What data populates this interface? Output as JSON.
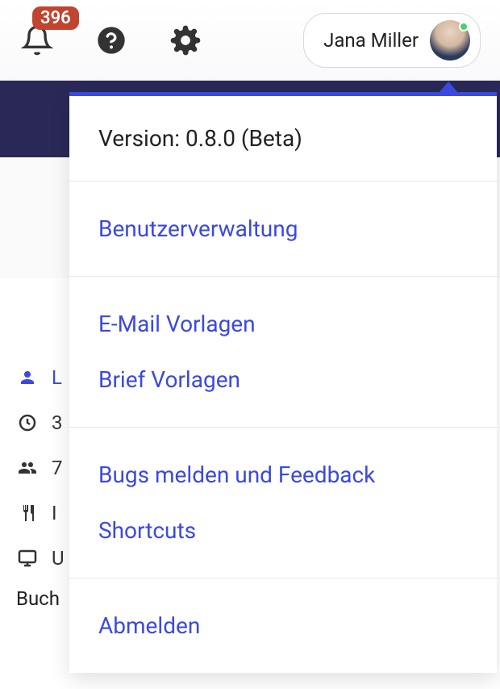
{
  "topbar": {
    "notification_count": "396",
    "user_name": "Jana Miller"
  },
  "dropdown": {
    "version": "Version: 0.8.0 (Beta)",
    "user_mgmt": "Benutzerverwaltung",
    "email_templates": "E-Mail Vorlagen",
    "letter_templates": "Brief Vorlagen",
    "bugs_feedback": "Bugs melden und Feedback",
    "shortcuts": "Shortcuts",
    "logout": "Abmelden"
  },
  "sidebar": {
    "items": [
      {
        "text": "L"
      },
      {
        "text": "3"
      },
      {
        "text": "7"
      },
      {
        "text": "I"
      },
      {
        "text": "U"
      }
    ],
    "buch": "Buch"
  }
}
